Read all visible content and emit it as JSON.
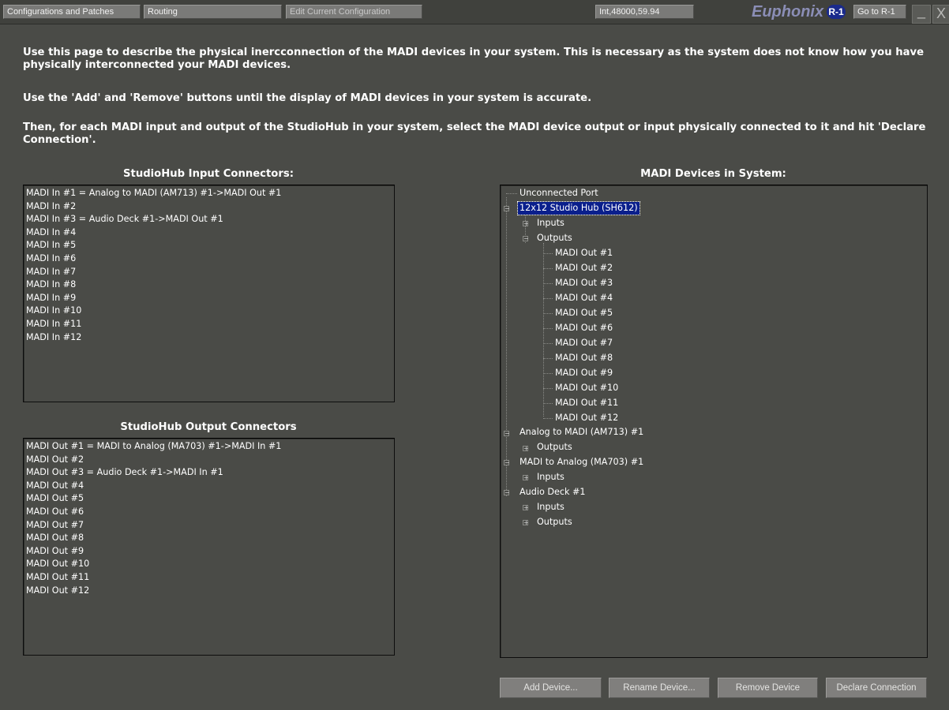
{
  "topbar": {
    "tab_config": "Configurations and Patches",
    "tab_routing": "Routing",
    "tab_edit": "Edit Current Configuration",
    "sample_rate": "Int,48000,59.94",
    "brand": "Euphonix",
    "badge": "R-1",
    "goto": "Go to R-1",
    "minimize": "_",
    "close": "X"
  },
  "instructions": {
    "p1": "Use this page to describe the physical inercconnection of the MADI devices in your system.  This is necessary as the system does not know how you have physically interconnected your MADI devices.",
    "p2": "Use the 'Add' and 'Remove' buttons until the display of MADI devices in your system is accurate.",
    "p3": "Then, for each MADI input and output of the StudioHub in your system, select the MADI device output or input physically connected to it and hit 'Declare Connection'."
  },
  "input_connectors": {
    "title": "StudioHub Input Connectors:",
    "items": [
      "MADI In #1 = Analog to MADI (AM713) #1->MADI Out #1",
      "MADI In #2",
      "MADI In #3 = Audio Deck #1->MADI Out #1",
      "MADI In #4",
      "MADI In #5",
      "MADI In #6",
      "MADI In #7",
      "MADI In #8",
      "MADI In #9",
      "MADI In #10",
      "MADI In #11",
      "MADI In #12"
    ]
  },
  "output_connectors": {
    "title": "StudioHub Output Connectors",
    "items": [
      "MADI Out #1 = MADI to Analog (MA703) #1->MADI In #1",
      "MADI Out #2",
      "MADI Out #3 = Audio Deck #1->MADI In #1",
      "MADI Out #4",
      "MADI Out #5",
      "MADI Out #6",
      "MADI Out #7",
      "MADI Out #8",
      "MADI Out #9",
      "MADI Out #10",
      "MADI Out #11",
      "MADI Out #12"
    ]
  },
  "devices": {
    "title": "MADI Devices in System:",
    "unconnected": "Unconnected Port",
    "hub": {
      "label": "12x12 Studio Hub (SH612)",
      "inputs": "Inputs",
      "outputs": "Outputs",
      "outputs_children": [
        "MADI Out #1",
        "MADI Out #2",
        "MADI Out #3",
        "MADI Out #4",
        "MADI Out #5",
        "MADI Out #6",
        "MADI Out #7",
        "MADI Out #8",
        "MADI Out #9",
        "MADI Out #10",
        "MADI Out #11",
        "MADI Out #12"
      ]
    },
    "am713": {
      "label": "Analog to MADI (AM713) #1",
      "outputs": "Outputs"
    },
    "ma703": {
      "label": "MADI to Analog (MA703) #1",
      "inputs": "Inputs"
    },
    "deck": {
      "label": "Audio Deck #1",
      "inputs": "Inputs",
      "outputs": "Outputs"
    },
    "expand_glyph": "+",
    "collapse_glyph": "−"
  },
  "buttons": {
    "add": "Add Device...",
    "rename": "Rename Device...",
    "remove": "Remove Device",
    "declare": "Declare Connection"
  }
}
